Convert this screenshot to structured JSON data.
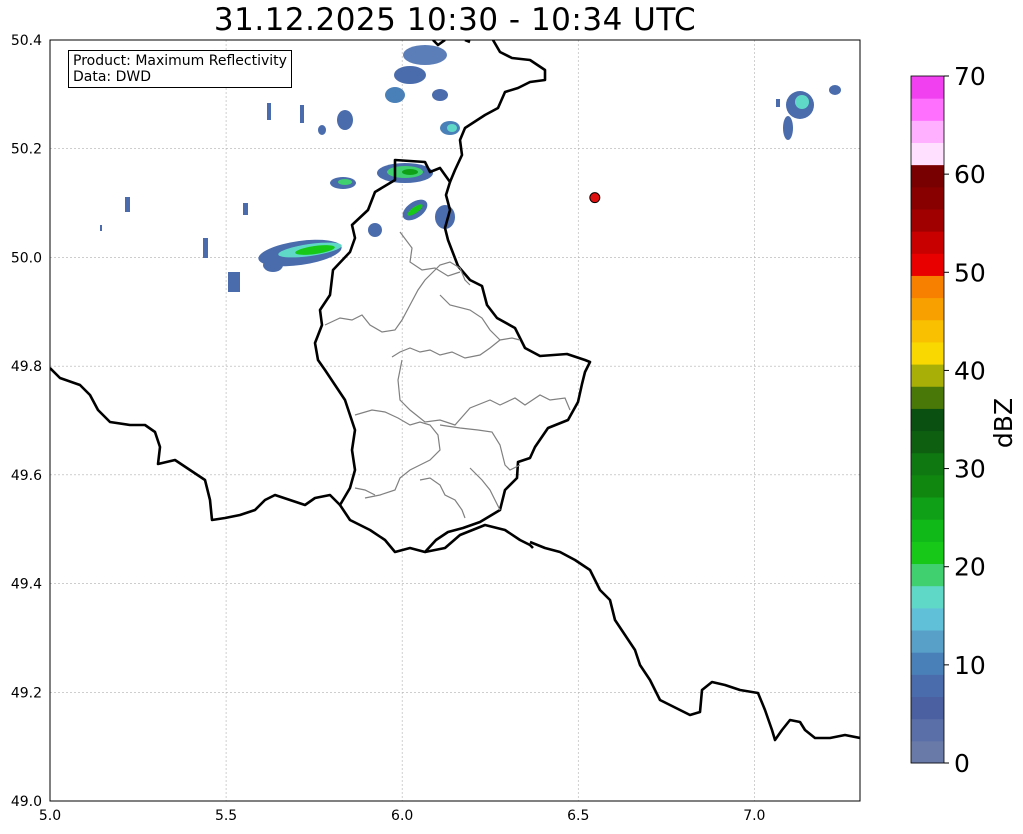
{
  "title": "31.12.2025 10:30 - 10:34 UTC",
  "info": {
    "product": "Product: Maximum Reflectivity",
    "data": "Data: DWD"
  },
  "map": {
    "lon_range": [
      5.0,
      7.3
    ],
    "lat_range": [
      49.0,
      50.4
    ],
    "x_ticks": [
      "5.0",
      "5.5",
      "6.0",
      "6.5",
      "7.0"
    ],
    "y_ticks": [
      "49.0",
      "49.2",
      "49.4",
      "49.6",
      "49.8",
      "50.0",
      "50.2",
      "50.4"
    ],
    "grid": true,
    "marker": {
      "lon": 6.547,
      "lat": 50.11,
      "color": "#e01010"
    }
  },
  "colorbar": {
    "label": "dBZ",
    "min": 0,
    "max": 70,
    "tick_labels": [
      "0",
      "10",
      "20",
      "30",
      "40",
      "50",
      "60",
      "70"
    ],
    "colors": [
      "#6a7aa8",
      "#5a6fa8",
      "#4a60a0",
      "#4a6cac",
      "#4a80b8",
      "#58a0c8",
      "#60c0d8",
      "#60d8c8",
      "#40d070",
      "#18c818",
      "#10b818",
      "#10a018",
      "#108810",
      "#107810",
      "#0e6010",
      "#0a5010",
      "#4a7808",
      "#a8b008",
      "#f8d800",
      "#f8c000",
      "#f8a000",
      "#f88000",
      "#e80000",
      "#c80000",
      "#a00000",
      "#880000",
      "#780000",
      "#ffe0ff",
      "#ffb0ff",
      "#ff70ff",
      "#f040f0"
    ]
  }
}
